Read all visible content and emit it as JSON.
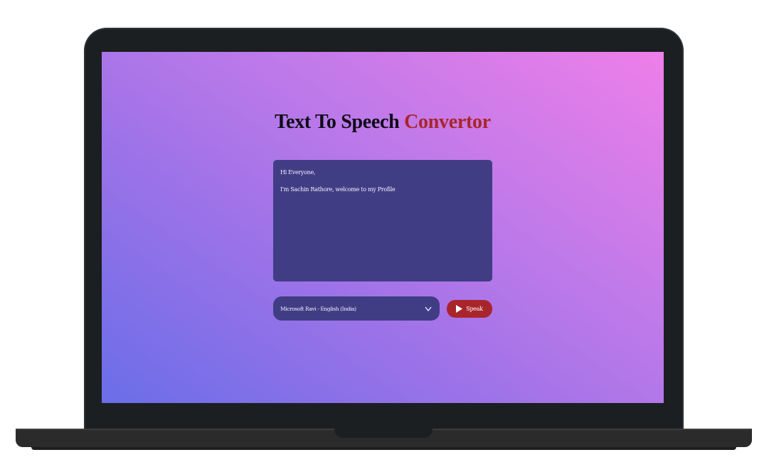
{
  "app": {
    "title_main": "Text To Speech",
    "title_accent": "Convertor"
  },
  "textarea": {
    "value": "Hi Everyone,\n\nI'm Sachin Rathore, welcome to my Profile"
  },
  "voice_select": {
    "selected": "Microsoft Ravi - English (India)",
    "icon": "chevron-down-icon"
  },
  "speak_button": {
    "label": "Speak",
    "icon": "play-icon"
  },
  "colors": {
    "accent": "#a8262b",
    "panel": "#413d85",
    "gradient_start": "#6a6ee8",
    "gradient_end": "#ee7fe9"
  }
}
